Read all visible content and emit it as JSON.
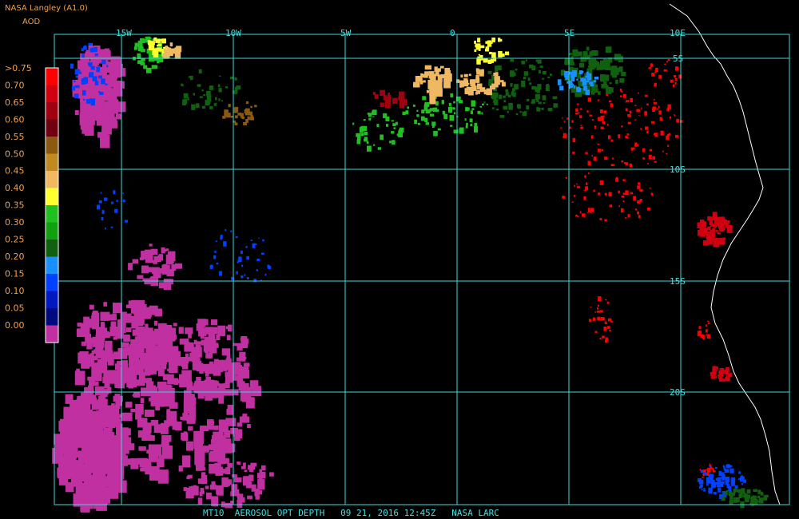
{
  "header": {
    "source": "NASA Langley (A1.0)",
    "product_abbrev": "AOD"
  },
  "footer": {
    "caption": "MT10  AEROSOL OPT DEPTH   09 21, 2016 12:45Z   NASA LARC"
  },
  "legend": {
    "labels": [
      ">0.75",
      "0.70",
      "0.65",
      "0.60",
      "0.55",
      "0.50",
      "0.45",
      "0.40",
      "0.35",
      "0.30",
      "0.25",
      "0.20",
      "0.15",
      "0.10",
      "0.05",
      "0.00"
    ],
    "colors": [
      "#ff0000",
      "#d00010",
      "#a00010",
      "#700010",
      "#8b5a10",
      "#c08a20",
      "#f0b860",
      "#ffff30",
      "#20c020",
      "#10a010",
      "#106010",
      "#1890ff",
      "#0040ff",
      "#0018c0",
      "#000a80",
      "#c030a0"
    ]
  },
  "map": {
    "longitude_labels": [
      "15W",
      "10W",
      "5W",
      "0",
      "5E",
      "10E"
    ],
    "latitude_labels": [
      "5S",
      "10S",
      "15S",
      "20S"
    ],
    "coastline_color": "#ffffff",
    "grid_color": "#40d8d8"
  }
}
